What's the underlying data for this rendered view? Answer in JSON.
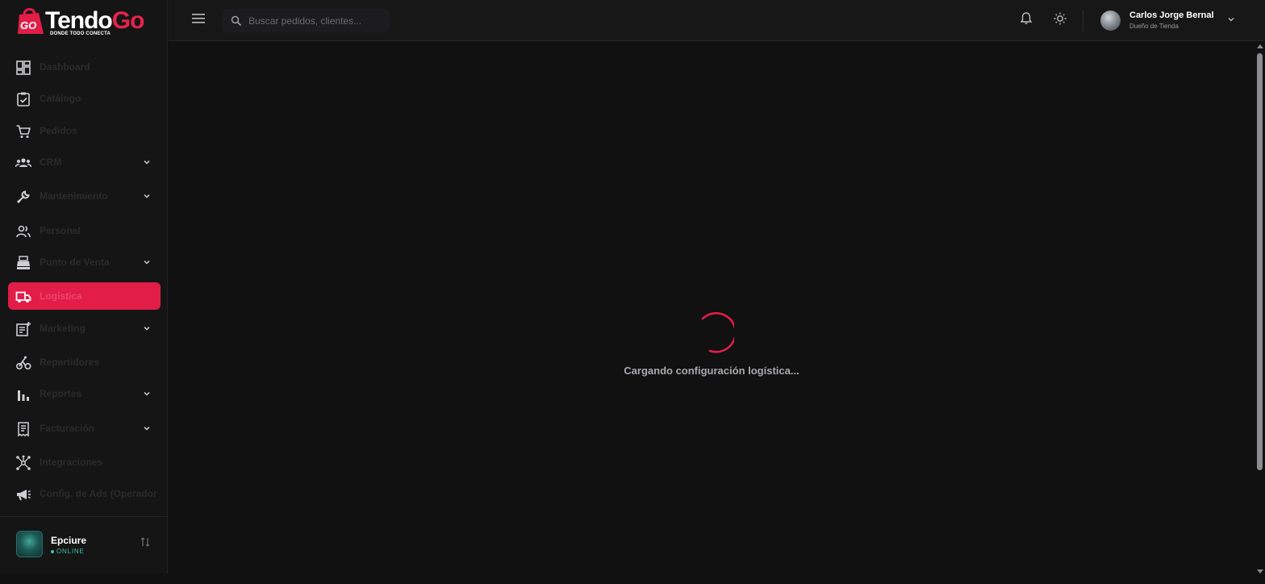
{
  "brand": {
    "name_part1": "Tendo",
    "name_part2": "Go",
    "badge": "GO",
    "tagline": "DONDE TODO CONECTA",
    "accent": "#e21d48"
  },
  "sidebar": {
    "items": [
      {
        "label": "Dashboard",
        "icon": "dashboard-icon",
        "expandable": false
      },
      {
        "label": "Catálogo",
        "icon": "clipboard-check-icon",
        "expandable": false
      },
      {
        "label": "Pedidos",
        "icon": "cart-icon",
        "expandable": false
      },
      {
        "label": "CRM",
        "icon": "users-group-icon",
        "expandable": true
      },
      {
        "label": "Mantenimiento",
        "icon": "wrench-icon",
        "expandable": true
      },
      {
        "label": "Personal",
        "icon": "people-icon",
        "expandable": false
      },
      {
        "label": "Punto de Venta",
        "icon": "cash-register-icon",
        "expandable": true
      },
      {
        "label": "Logística",
        "icon": "truck-icon",
        "expandable": false,
        "active": true
      },
      {
        "label": "Marketing",
        "icon": "newspaper-plus-icon",
        "expandable": true
      },
      {
        "label": "Repartidores",
        "icon": "bike-icon",
        "expandable": false
      },
      {
        "label": "Reportes",
        "icon": "bar-chart-icon",
        "expandable": true
      },
      {
        "label": "Facturación",
        "icon": "receipt-icon",
        "expandable": true
      },
      {
        "label": "Integraciones",
        "icon": "hub-icon",
        "expandable": false
      },
      {
        "label": "Config. de Ads (Operador",
        "icon": "megaphone-icon",
        "expandable": false
      }
    ],
    "store": {
      "name": "Epciure",
      "status": "ONLINE"
    }
  },
  "topbar": {
    "search_placeholder": "Buscar pedidos, clientes...",
    "user_name": "Carlos Jorge Bernal",
    "user_role": "Dueño de Tienda"
  },
  "main": {
    "loading_text": "Cargando configuración logística..."
  }
}
